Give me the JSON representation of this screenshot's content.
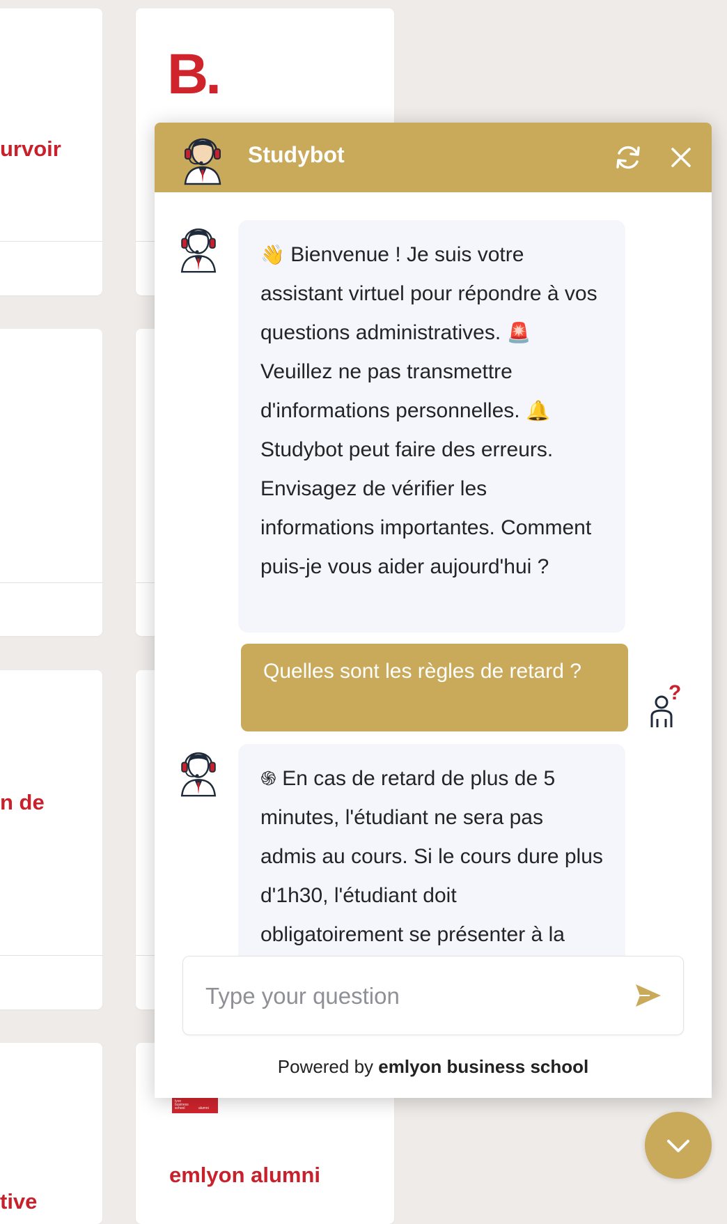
{
  "background": {
    "cards_left": [
      {
        "title": "urvoir"
      },
      {
        "title": ""
      },
      {
        "title": "n de"
      },
      {
        "title": "tive"
      }
    ],
    "brand_letter": "B.",
    "alumni_card": {
      "title": "emlyon alumni",
      "logo_text_1": "lyon",
      "logo_text_2": "business",
      "logo_text_3": "school",
      "logo_text_4": "alumni"
    }
  },
  "chat": {
    "title": "Studybot",
    "refresh_icon": "refresh-icon",
    "close_icon": "close-icon",
    "messages": [
      {
        "role": "bot",
        "emoji_1": "👋",
        "text_1": " Bienvenue ! Je suis votre assistant virtuel pour répondre à vos questions administratives. ",
        "emoji_2": "🚨",
        "text_2": " Veuillez ne pas transmettre d'informations personnelles. ",
        "emoji_3": "🔔",
        "text_3": " Studybot peut faire des erreurs. Envisagez de vérifier les informations importantes. Comment puis-je vous aider aujourd'hui ?"
      },
      {
        "role": "user",
        "text": "Quelles sont les règles de retard ?"
      },
      {
        "role": "bot",
        "emoji_1": "֍",
        "text_1": " En cas de retard de plus de 5 minutes, l'étudiant ne sera pas admis au cours. Si le cours dure plus d'1h30, l'étudiant doit obligatoirement se présenter à la"
      }
    ],
    "input": {
      "placeholder": "Type your question",
      "value": ""
    },
    "powered_prefix": "Powered by ",
    "powered_brand": "emlyon business school"
  },
  "colors": {
    "accent": "#c9a95a",
    "brand_red": "#c8212b",
    "bot_bubble": "#f5f6fb"
  }
}
